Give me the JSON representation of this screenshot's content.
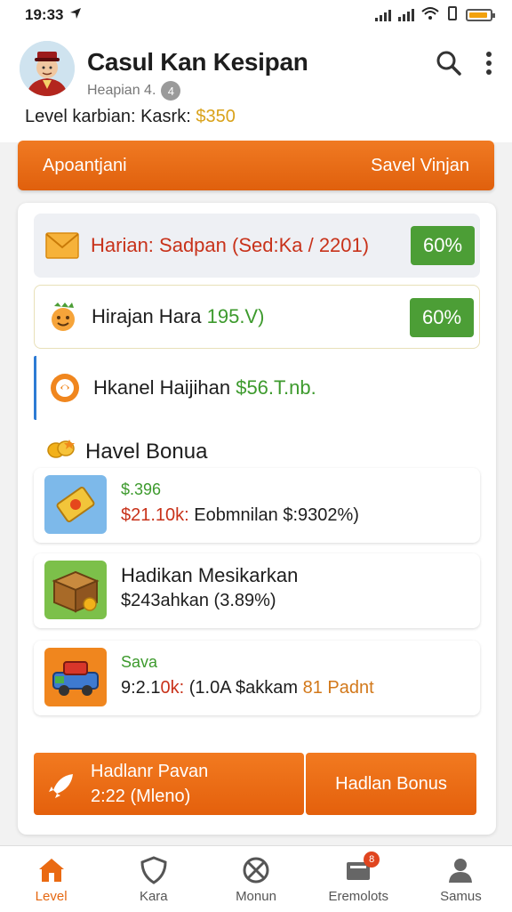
{
  "status_bar": {
    "time": "19:33"
  },
  "header": {
    "title": "Casul Kan Kesipan",
    "subtitle": "Heapian 4.",
    "subtitle_badge": "4",
    "level_prefix": "Level karbian: Kasrk: ",
    "level_value": "$350"
  },
  "action_bar": {
    "left_label": "Apoantjani",
    "right_label": "Savel Vinjan"
  },
  "rows": [
    {
      "text": "Harian: Sadpan (Sed:Ka / 2201)",
      "pct": "60%"
    },
    {
      "label": "Hirajan Hara ",
      "value": "195.V)",
      "pct": "60%"
    },
    {
      "label": "Hkanel Haijihan ",
      "value": "$56.T.nb."
    }
  ],
  "section": {
    "title": "Havel Bonua"
  },
  "cards": [
    {
      "line1": "$.396",
      "amount": "$21.10k: ",
      "desc": "Eobmnilan $:9302%)"
    },
    {
      "line1": "Hadikan Mesikarkan",
      "desc": "$243ahkan (3.89%)"
    },
    {
      "line1": "Sava",
      "amount_a": "9:2.1",
      "amount_b": "0k: ",
      "desc": "(1.0A $akkam ",
      "tail": "81 Padnt"
    }
  ],
  "big_buttons": {
    "left_line1": "Hadlanr Pavan",
    "left_line2": "2:22 (Mleno)",
    "right_label": "Hadlan Bonus"
  },
  "nav": [
    {
      "label": "Level",
      "icon": "home-icon"
    },
    {
      "label": "Kara",
      "icon": "shield-icon"
    },
    {
      "label": "Monun",
      "icon": "globe-icon"
    },
    {
      "label": "Eremolots",
      "icon": "inbox-icon",
      "badge": "8"
    },
    {
      "label": "Samus",
      "icon": "profile-icon"
    }
  ],
  "colors": {
    "accent": "#e8680f",
    "green": "#4c9e36",
    "gold": "#d9a21a",
    "red_text": "#c8321a"
  }
}
